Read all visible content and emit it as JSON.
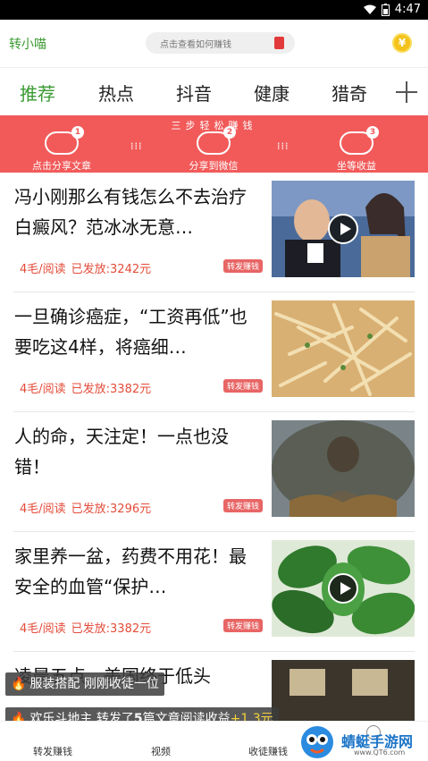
{
  "status_bar": {
    "time": "4:47"
  },
  "header": {
    "brand": "转小喵",
    "search_placeholder": "点击查看如何赚钱"
  },
  "tabs": [
    {
      "label": "推荐",
      "active": true
    },
    {
      "label": "热点"
    },
    {
      "label": "抖音"
    },
    {
      "label": "健康"
    },
    {
      "label": "猎奇"
    }
  ],
  "banner": {
    "title": "三步轻松赚钱",
    "steps": [
      {
        "num": "1",
        "label": "点击分享文章"
      },
      {
        "num": "2",
        "label": "分享到微信"
      },
      {
        "num": "3",
        "label": "坐等收益"
      }
    ]
  },
  "articles": [
    {
      "title": "冯小刚那么有钱怎么不去治疗白癜风？范冰冰无意…",
      "price": "4毛/阅读",
      "paid": "已发放:3242元",
      "badge": "转发赚钱",
      "video": true
    },
    {
      "title": "一旦确诊癌症，“工资再低”也要吃这4样，将癌细…",
      "price": "4毛/阅读",
      "paid": "已发放:3382元",
      "badge": "转发赚钱",
      "video": false
    },
    {
      "title": "人的命，天注定！一点也没错！",
      "price": "4毛/阅读",
      "paid": "已发放:3296元",
      "badge": "转发赚钱",
      "video": false
    },
    {
      "title": "家里养一盆，药费不用花！最安全的血管“保护…",
      "price": "4毛/阅读",
      "paid": "已发放:3382元",
      "badge": "转发赚钱",
      "video": true
    },
    {
      "title": "凌晨五点，美国终于低头",
      "price": "",
      "paid": "",
      "badge": "",
      "video": false
    }
  ],
  "toasts": [
    {
      "text": "服装搭配 刚刚收徒一位"
    },
    {
      "prefix": "欢乐斗地主 转发了",
      "count": "5",
      "suffix": "篇文章阅读收益",
      "gain": "+1.3元"
    }
  ],
  "bottom_nav": [
    {
      "label": "转发赚钱"
    },
    {
      "label": "视频"
    },
    {
      "label": "收徒赚钱"
    }
  ],
  "watermark": {
    "title": "蜻蜓手游网",
    "sub": "www.QT6.com"
  },
  "colors": {
    "accent": "#3a9a32",
    "banner": "#f25a5a",
    "price": "#e44c3a"
  }
}
